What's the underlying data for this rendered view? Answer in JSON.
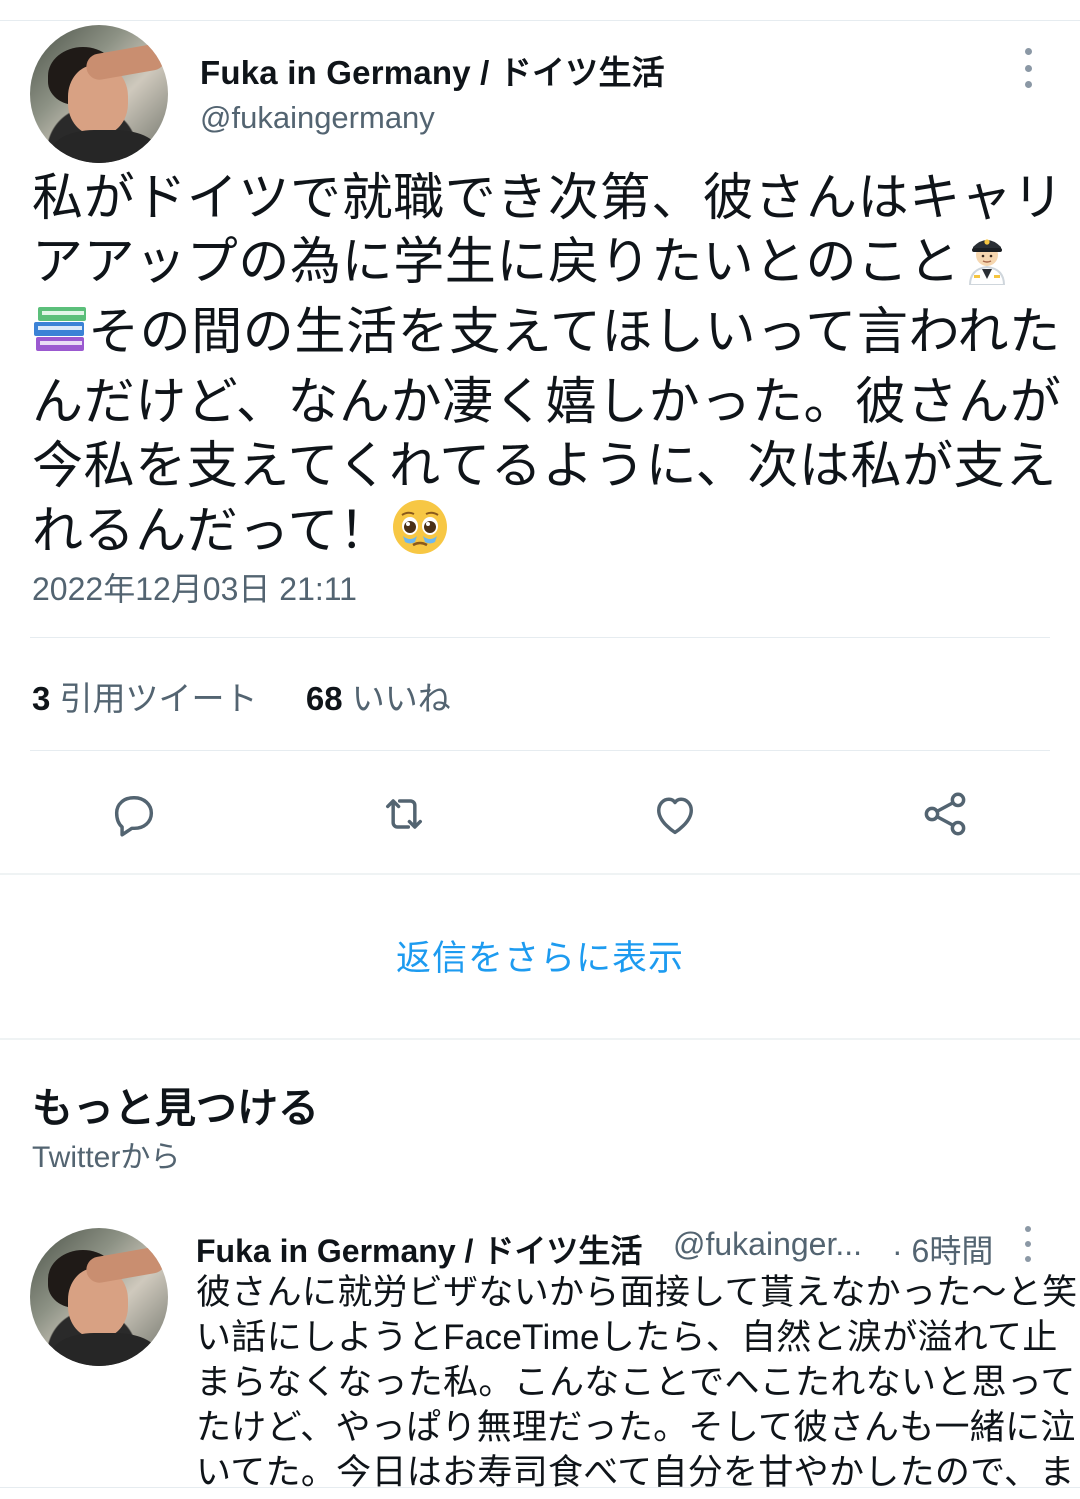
{
  "main_tweet": {
    "author_name": "Fuka in Germany / ドイツ生活",
    "author_handle": "@fukaingermany",
    "lines": [
      "私がドイツで就職でき次第、彼さんはキャリ",
      "アアップの為に学生に戻りたいとのこと",
      "その間の生活を支えてほしいって言われた",
      "んだけど、なんか凄く嬉しかった。彼さんが",
      "今私を支えてくれてるように、次は私が支え",
      "れるんだって！"
    ],
    "emojis": [
      "pilot",
      "books",
      "pleading-face"
    ],
    "timestamp": "2022年12月03日 21:11",
    "quote_count": "3",
    "quote_label": "引用ツイート",
    "like_count": "68",
    "like_label": "いいね"
  },
  "actions": [
    {
      "name": "reply-icon"
    },
    {
      "name": "retweet-icon"
    },
    {
      "name": "like-icon"
    },
    {
      "name": "share-icon"
    }
  ],
  "more_replies_label": "返信をさらに表示",
  "discover": {
    "title": "もっと見つける",
    "subtitle": "Twitterから"
  },
  "recommended_tweet": {
    "author_name": "Fuka in Germany / ドイツ生活",
    "author_handle": "@fukainger...",
    "time": "· 6時間",
    "lines": [
      "彼さんに就労ビザないから面接して貰えなかった〜と笑",
      "い話にしようとFaceTimeしたら、自然と涙が溢れて止",
      "まらなくなった私。こんなことでへこたれないと思って",
      "たけど、やっぱり無理だった。そして彼さんも一緒に泣",
      "いてた。今日はお寿司食べて自分を甘やかしたので、ま"
    ]
  },
  "colors": {
    "accent": "#1d9bf0",
    "secondary_text": "#536471",
    "icon": "#536471"
  }
}
